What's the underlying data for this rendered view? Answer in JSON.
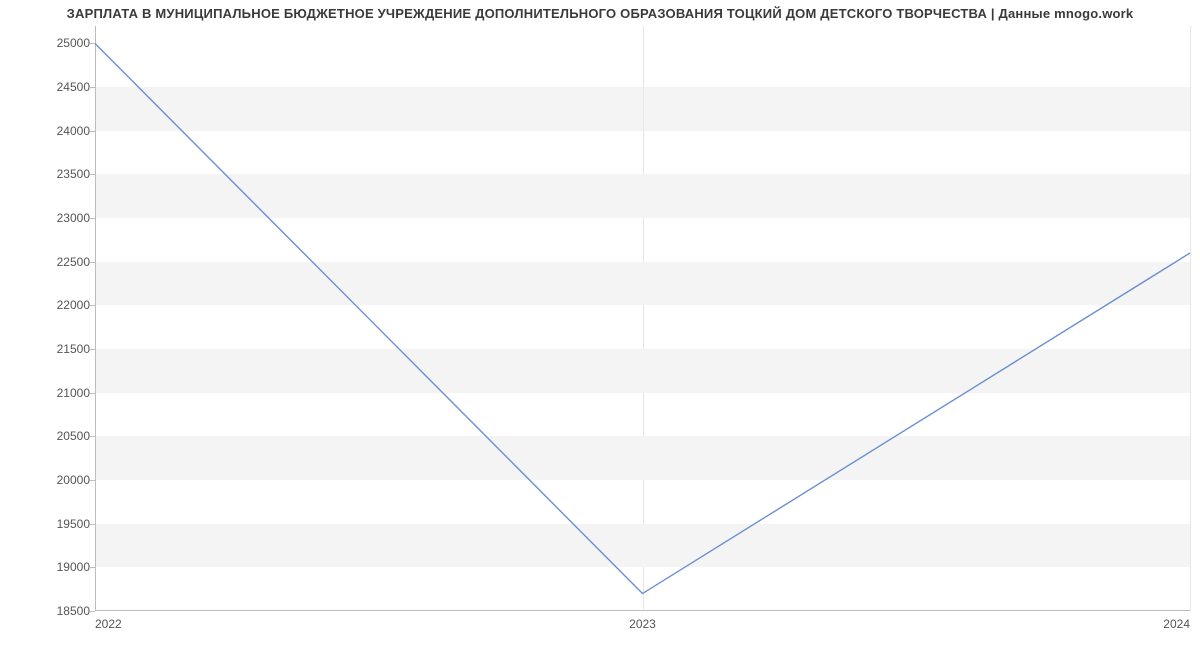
{
  "chart_data": {
    "type": "line",
    "title": "ЗАРПЛАТА В МУНИЦИПАЛЬНОЕ БЮДЖЕТНОЕ УЧРЕЖДЕНИЕ ДОПОЛНИТЕЛЬНОГО ОБРАЗОВАНИЯ ТОЦКИЙ ДОМ ДЕТСКОГО ТВОРЧЕСТВА | Данные mnogo.work",
    "x": [
      2022,
      2023,
      2024
    ],
    "x_ticks": [
      "2022",
      "2023",
      "2024"
    ],
    "values": [
      25000,
      18700,
      22600
    ],
    "xlabel": "",
    "ylabel": "",
    "ylim": [
      18500,
      25200
    ],
    "xlim": [
      2022,
      2024
    ],
    "y_ticks": [
      18500,
      19000,
      19500,
      20000,
      20500,
      21000,
      21500,
      22000,
      22500,
      23000,
      23500,
      24000,
      24500,
      25000
    ],
    "line_color": "#6b8fd4",
    "band_color": "#f4f4f4"
  }
}
